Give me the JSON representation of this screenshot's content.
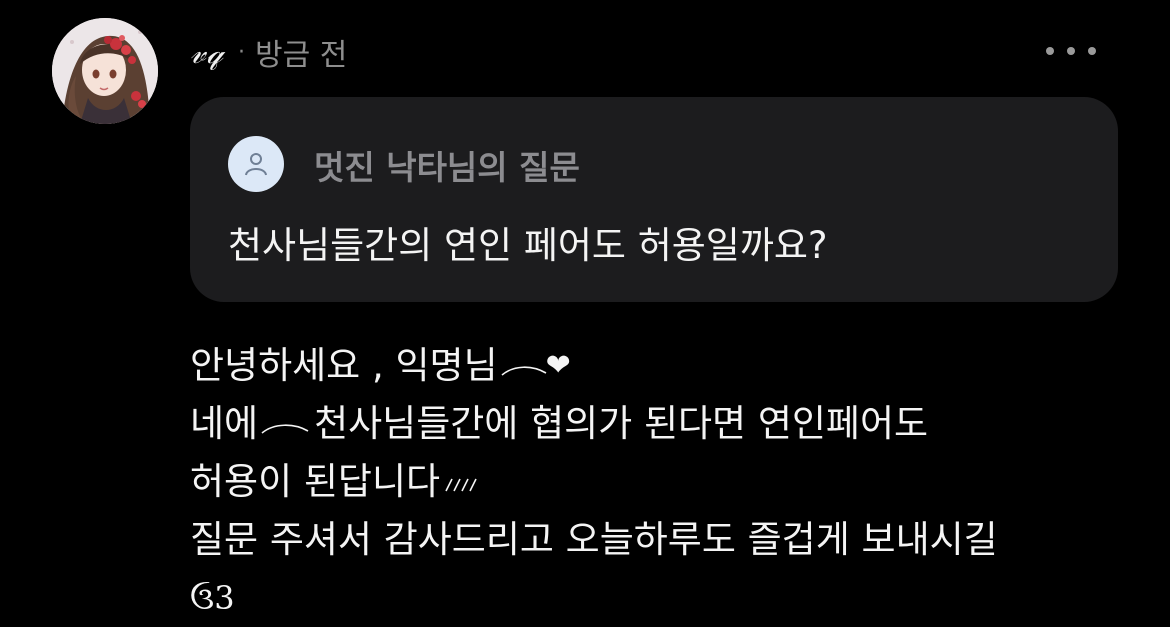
{
  "post": {
    "username": "𝓋𝓆",
    "separator": "·",
    "timestamp": "방금 전",
    "more_icon": "more-horizontal-icon"
  },
  "question": {
    "author": "멋진 낙타님의 질문",
    "text": "천사님들간의 연인 페어도 허용일까요?",
    "avatar_icon": "user-icon"
  },
  "answer": {
    "line1": "안녕하세요 , 익명님",
    "line1_heart": "❤",
    "line2_start": "네에",
    "line2_end": " 천사님들간에 협의가 된다면 연인페어도",
    "line3": "허용이 된답니다",
    "line4": "질문 주셔서 감사드리고 오늘하루도 즐겁게 보내시길",
    "line5": "ઉ3"
  },
  "colors": {
    "background": "#000000",
    "card": "#1c1c1e",
    "muted_text": "#8e8e8e",
    "question_avatar_bg": "#dce8f7"
  }
}
